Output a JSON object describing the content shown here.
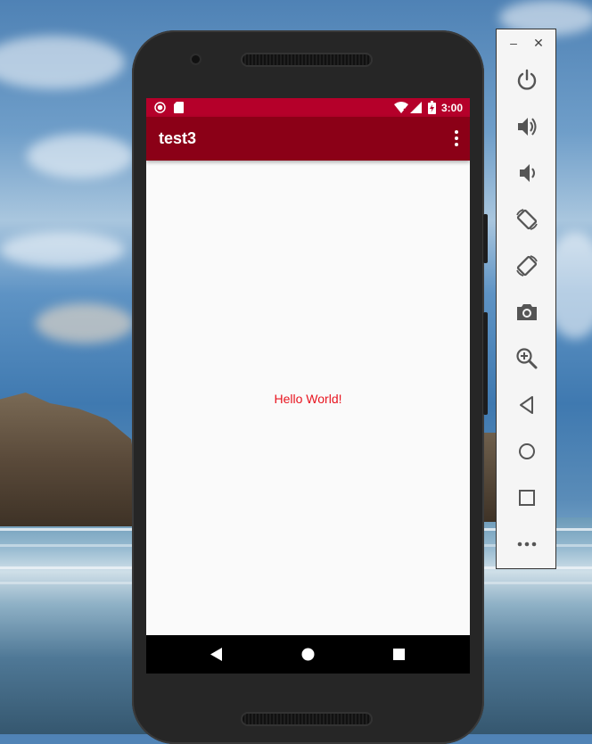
{
  "app": {
    "title": "test3",
    "content_text": "Hello World!"
  },
  "statusbar": {
    "time": "3:00",
    "left_icons": [
      "record-indicator-icon",
      "sd-card-icon"
    ],
    "right_icons": [
      "wifi-icon",
      "cellular-signal-icon",
      "battery-charging-icon"
    ]
  },
  "navbar": {
    "buttons": [
      "back-icon",
      "home-icon",
      "recents-icon"
    ]
  },
  "emulator_toolbar": {
    "window_controls": [
      "minimize-icon",
      "close-icon"
    ],
    "minimize_glyph": "–",
    "close_glyph": "✕",
    "buttons": [
      "power-icon",
      "volume-up-icon",
      "volume-down-icon",
      "rotate-left-icon",
      "rotate-right-icon",
      "screenshot-camera-icon",
      "zoom-icon",
      "back-triangle-icon",
      "home-circle-icon",
      "overview-square-icon",
      "more-icon"
    ]
  },
  "colors": {
    "statusbar": "#b5002a",
    "appbar": "#8b0017",
    "content_text": "#e8141f",
    "screen_background": "#fafafa",
    "navbar": "#000000",
    "toolbar_icon": "#555555"
  }
}
